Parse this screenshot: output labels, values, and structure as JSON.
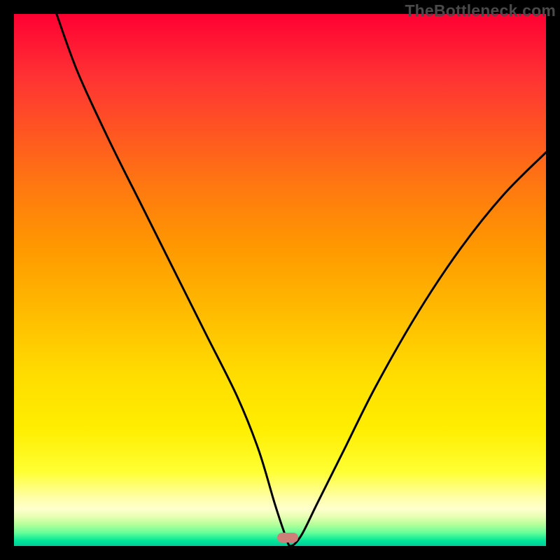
{
  "watermark": {
    "text": "TheBottleneck.com"
  },
  "marker": {
    "x_frac": 0.515,
    "y_frac": 0.984
  },
  "chart_data": {
    "type": "line",
    "title": "",
    "xlabel": "",
    "ylabel": "",
    "xlim": [
      0,
      100
    ],
    "ylim": [
      0,
      100
    ],
    "series": [
      {
        "name": "bottleneck-curve",
        "x": [
          8,
          12,
          18,
          24,
          30,
          36,
          42,
          46,
          49,
          51,
          52,
          54,
          57,
          62,
          68,
          76,
          84,
          92,
          100
        ],
        "y": [
          100,
          89,
          76,
          64,
          52,
          40,
          28,
          18,
          8,
          2,
          0,
          2,
          8,
          18,
          30,
          44,
          56,
          66,
          74
        ]
      }
    ],
    "annotations": [
      {
        "type": "marker",
        "shape": "rounded-rect",
        "x": 51.5,
        "y": 1.6,
        "color": "#cd7f7a"
      }
    ],
    "background_gradient": {
      "direction": "vertical",
      "stops": [
        {
          "pos": 0.0,
          "color": "#ff0033"
        },
        {
          "pos": 0.45,
          "color": "#ff9900"
        },
        {
          "pos": 0.8,
          "color": "#ffff33"
        },
        {
          "pos": 0.94,
          "color": "#ffffcc"
        },
        {
          "pos": 1.0,
          "color": "#00cc99"
        }
      ]
    }
  }
}
